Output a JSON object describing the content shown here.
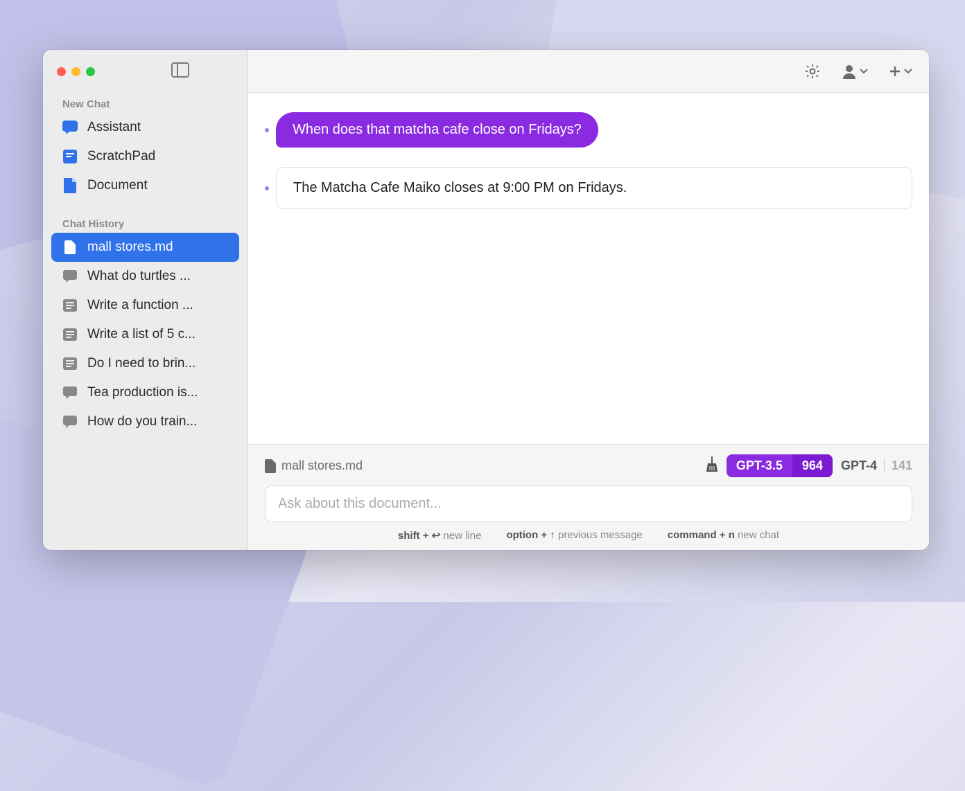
{
  "sidebar": {
    "new_chat_label": "New Chat",
    "new_items": [
      {
        "label": "Assistant",
        "icon": "chat"
      },
      {
        "label": "ScratchPad",
        "icon": "scratchpad"
      },
      {
        "label": "Document",
        "icon": "document"
      }
    ],
    "history_label": "Chat History",
    "history_items": [
      {
        "label": "mall stores.md",
        "icon": "document",
        "selected": true
      },
      {
        "label": "What do turtles ...",
        "icon": "chat-grey"
      },
      {
        "label": "Write a function ...",
        "icon": "note"
      },
      {
        "label": "Write a list of 5 c...",
        "icon": "note"
      },
      {
        "label": "Do I need to brin...",
        "icon": "note"
      },
      {
        "label": "Tea production is...",
        "icon": "chat-grey"
      },
      {
        "label": "How do you train...",
        "icon": "chat-grey"
      }
    ]
  },
  "chat": {
    "user_message": "When does that matcha cafe close on Fridays?",
    "assistant_message": "The Matcha Cafe Maiko closes at 9:00 PM on Fridays."
  },
  "footer": {
    "doc_name": "mall stores.md",
    "models": {
      "active": {
        "name": "GPT-3.5",
        "count": "964"
      },
      "inactive": {
        "name": "GPT-4",
        "count": "141"
      }
    },
    "input_placeholder": "Ask about this document...",
    "hints": [
      {
        "key": "shift + ↩",
        "desc": "new line"
      },
      {
        "key": "option + ↑",
        "desc": "previous message"
      },
      {
        "key": "command + n",
        "desc": "new chat"
      }
    ]
  }
}
